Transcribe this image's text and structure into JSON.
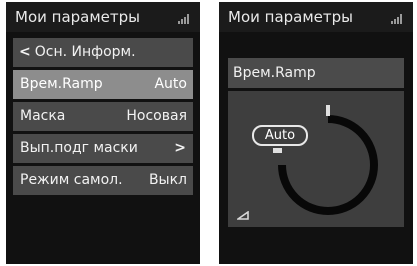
{
  "left": {
    "title": "Мои параметры",
    "menu": [
      {
        "label": "Осн. Информ.",
        "kind": "back"
      },
      {
        "label": "Врем.Ramp",
        "value": "Auto",
        "selected": true
      },
      {
        "label": "Маска",
        "value": "Носовая"
      },
      {
        "label": "Вып.подг маски",
        "kind": "submenu"
      },
      {
        "label": "Режим самол.",
        "value": "Выкл"
      }
    ]
  },
  "right": {
    "title": "Мои параметры",
    "param_label": "Врем.Ramp",
    "dial_value": "Auto"
  },
  "icons": {
    "signal": "signal-strength-icon",
    "back": "chevron-left-icon",
    "submenu": "chevron-right-icon",
    "ramp": "ramp-icon"
  },
  "colors": {
    "device_bg": "#111111",
    "row_bg": "#4a4a4a",
    "row_selected_bg": "#8d8d8d",
    "panel_bg": "#3e3e3e",
    "text": "#f2f2f2"
  }
}
